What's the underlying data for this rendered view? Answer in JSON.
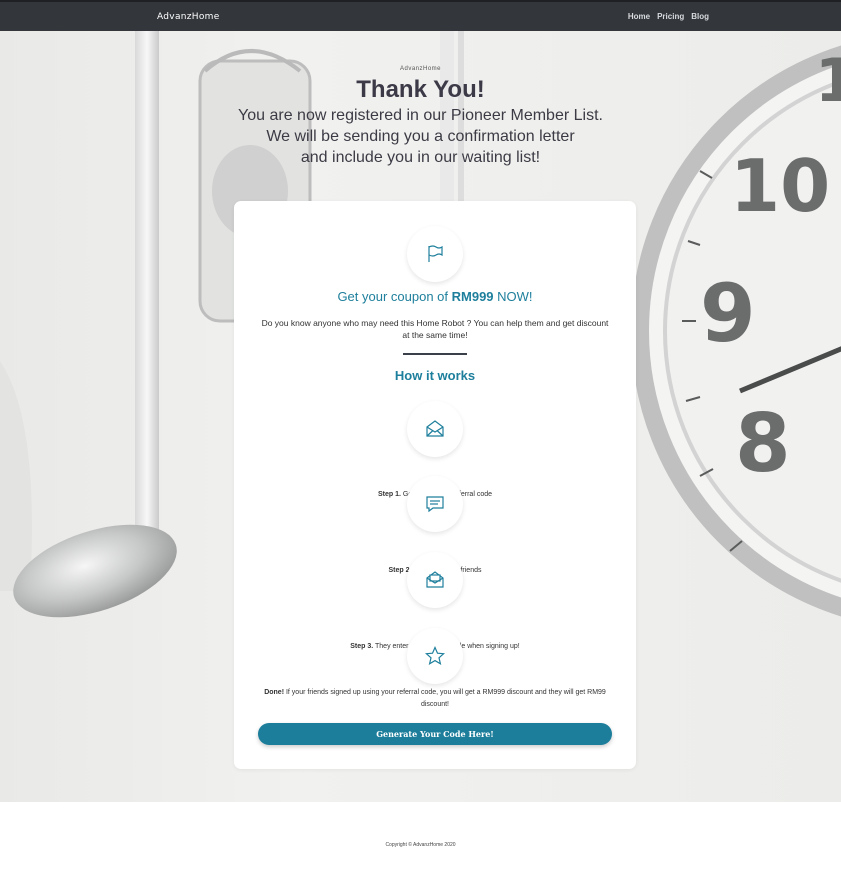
{
  "navbar": {
    "brand": "AdvanzHome",
    "links": [
      "Home",
      "Pricing",
      "Blog"
    ]
  },
  "hero": {
    "mini_brand": "AdvanzHome",
    "title": "Thank You!",
    "subtitle_lines": [
      "You are now registered in our Pioneer Member List.",
      "We will be sending you a confirmation letter",
      "and include you in our waiting list!"
    ]
  },
  "card": {
    "top_icon": "flag-icon",
    "coupon_prefix": "Get your coupon of ",
    "coupon_amount": "RM999",
    "coupon_suffix": " NOW!",
    "description": "Do you know anyone who may need this Home Robot ? You can help them and get discount at the same time!",
    "how_title": "How it works",
    "steps": [
      {
        "icon": "envelope-icon",
        "label": "Step 1.",
        "text": " Generate Your Referral code"
      },
      {
        "icon": "chat-icon",
        "label": "Step 2.",
        "text": " Share it to you friends"
      },
      {
        "icon": "envelope-open-icon",
        "label": "Step 3.",
        "text": " They enter your referral code when signing up!"
      },
      {
        "icon": "star-icon",
        "label": "Done!",
        "text": " If your friends signed up using your referral code, you will get a RM999 discount and they will get RM99 discount!"
      }
    ],
    "cta_label": "Generate Your Code Here!"
  },
  "footer": {
    "copyright": "Copyright © AdvanzHome 2020"
  },
  "colors": {
    "accent": "#1e7f9c",
    "navbar": "#33373c",
    "title": "#3d3a48"
  }
}
